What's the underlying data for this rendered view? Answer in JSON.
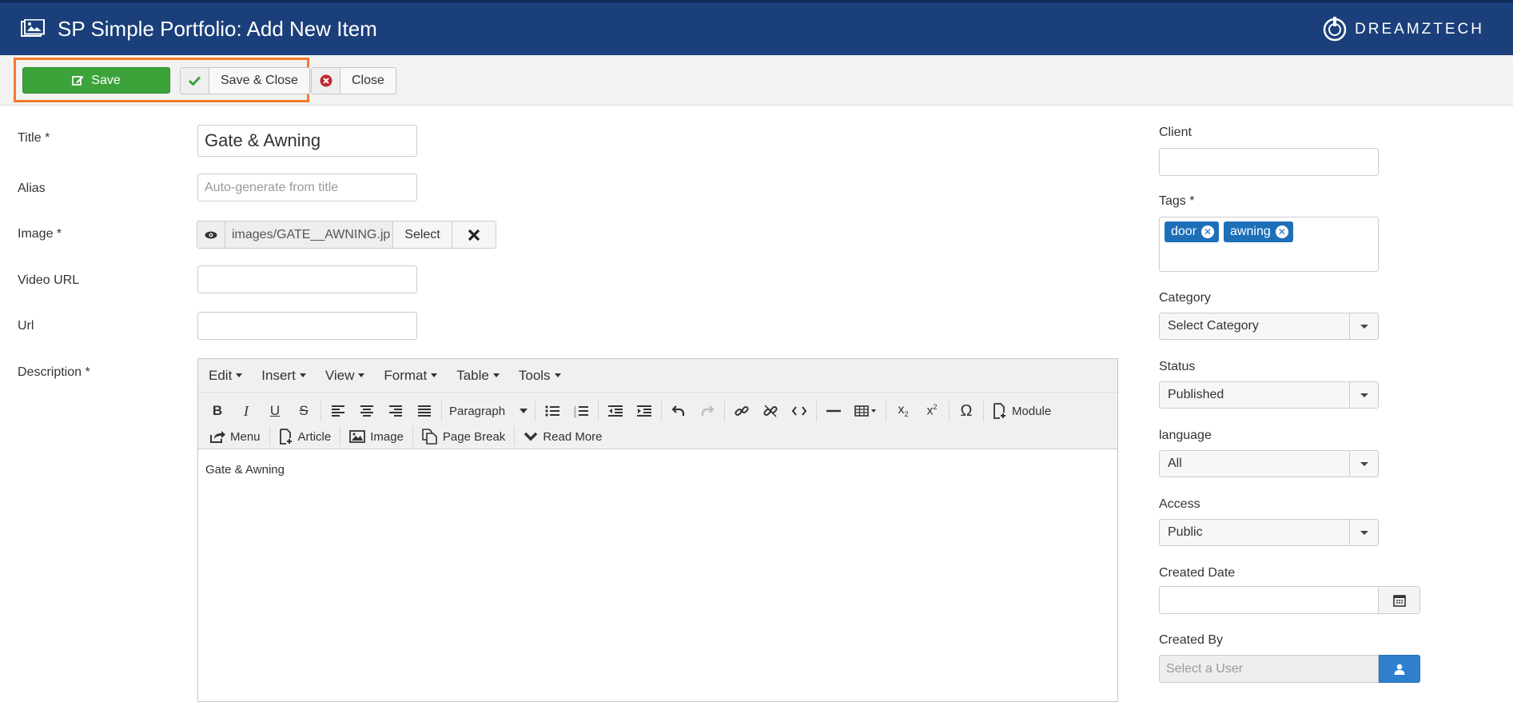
{
  "header": {
    "title": "SP Simple Portfolio: Add New Item",
    "brand": "DREAMZTECH",
    "bg_color": "#1b3f7a"
  },
  "toolbar": {
    "save_label": "Save",
    "save_close_label": "Save & Close",
    "close_label": "Close",
    "save_color": "#3ba33a",
    "highlight_color": "#f47a2c"
  },
  "form": {
    "title_label": "Title *",
    "title_value": "Gate & Awning",
    "alias_label": "Alias",
    "alias_placeholder": "Auto-generate from title",
    "image_label": "Image *",
    "image_path": "images/GATE__AWNING.jp",
    "image_select_label": "Select",
    "video_label": "Video URL",
    "video_value": "",
    "url_label": "Url",
    "url_value": "",
    "description_label": "Description *"
  },
  "editor": {
    "menus": [
      "Edit",
      "Insert",
      "View",
      "Format",
      "Table",
      "Tools"
    ],
    "format_select": "Paragraph",
    "module_label": "Module",
    "menu_label": "Menu",
    "article_label": "Article",
    "image_label": "Image",
    "pagebreak_label": "Page Break",
    "readmore_label": "Read More",
    "content": "Gate & Awning"
  },
  "sidebar": {
    "client_label": "Client",
    "client_value": "",
    "tags_label": "Tags *",
    "tags": [
      "door",
      "awning"
    ],
    "category_label": "Category",
    "category_value": "Select Category",
    "status_label": "Status",
    "status_value": "Published",
    "language_label": "language",
    "language_value": "All",
    "access_label": "Access",
    "access_value": "Public",
    "created_date_label": "Created Date",
    "created_date_value": "",
    "created_by_label": "Created By",
    "created_by_placeholder": "Select a User"
  }
}
